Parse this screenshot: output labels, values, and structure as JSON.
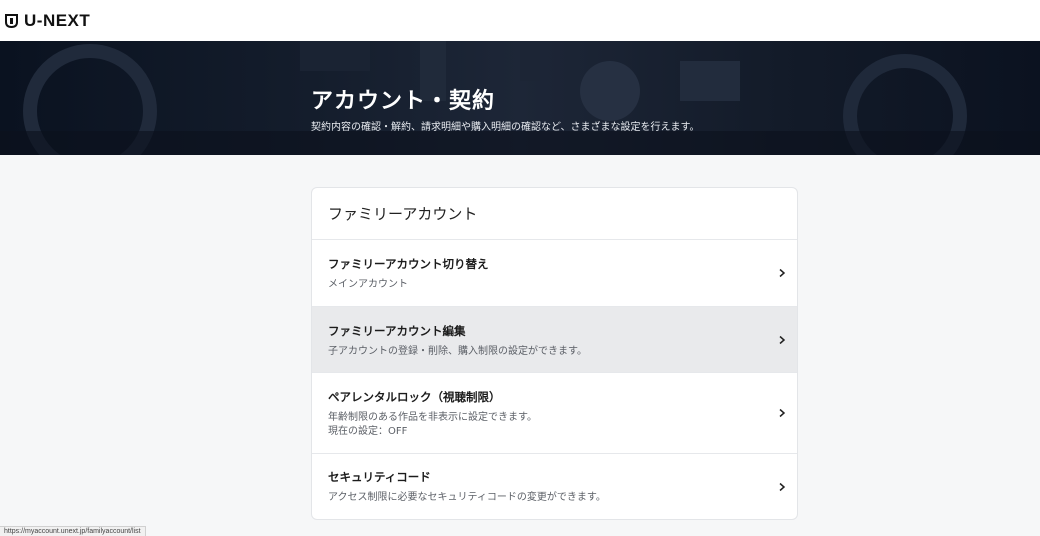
{
  "header": {
    "logo_text": "U-NEXT",
    "logo_icon": "shield-logo-icon"
  },
  "hero": {
    "title": "アカウント・契約",
    "subtitle": "契約内容の確認・解約、請求明細や購入明細の確認など、さまざまな設定を行えます。"
  },
  "card": {
    "title": "ファミリーアカウント",
    "items": [
      {
        "title": "ファミリーアカウント切り替え",
        "desc": "メインアカウント",
        "icon": "chevron-right-icon"
      },
      {
        "title": "ファミリーアカウント編集",
        "desc": "子アカウントの登録・削除、購入制限の設定ができます。",
        "icon": "chevron-right-icon"
      },
      {
        "title": "ペアレンタルロック（視聴制限）",
        "desc": "年齢制限のある作品を非表示に設定できます。",
        "desc2": "現在の設定：OFF",
        "icon": "chevron-right-icon"
      },
      {
        "title": "セキュリティコード",
        "desc": "アクセス制限に必要なセキュリティコードの変更ができます。",
        "icon": "chevron-right-icon"
      }
    ]
  },
  "status_bar": {
    "url": "https://myaccount.unext.jp/familyaccount/list"
  }
}
